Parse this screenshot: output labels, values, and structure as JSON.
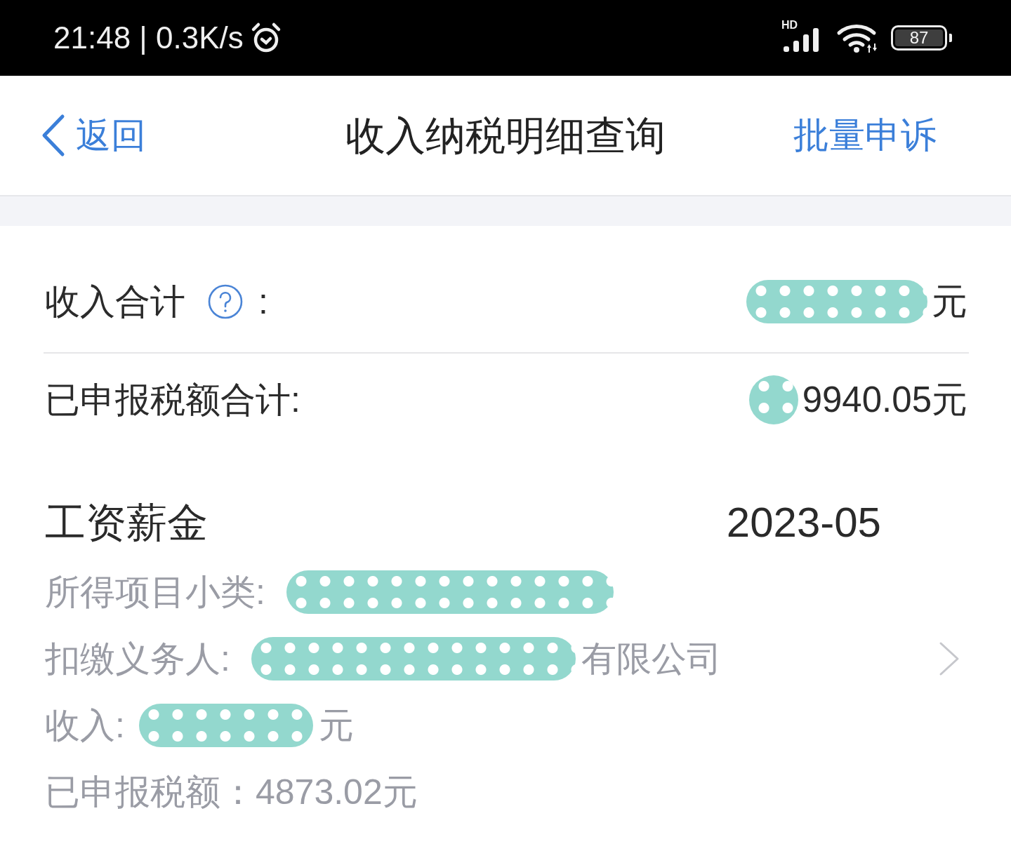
{
  "status_bar": {
    "time": "21:48 | 0.3K/s",
    "signal_label": "HD",
    "battery": "87"
  },
  "header": {
    "back": "返回",
    "title": "收入纳税明细查询",
    "action": "批量申诉"
  },
  "summary": [
    {
      "label": "收入合计",
      "help": true,
      "suffix": ":",
      "masked": true,
      "value": "元"
    },
    {
      "label": "已申报税额合计:",
      "help": false,
      "masked": true,
      "value": "9940.05元"
    }
  ],
  "records": [
    {
      "category": "工资薪金",
      "period": "2023-05",
      "lines": [
        {
          "label": "所得项目小类:",
          "masked": true,
          "chevron": false
        },
        {
          "label": "扣缴义务人:",
          "masked": true,
          "value": "有限公司",
          "chevron": true
        },
        {
          "label": "收入:",
          "masked": true,
          "value": "元",
          "chevron": false
        },
        {
          "label": "已申报税额：4873.02元",
          "masked": false,
          "chevron": false
        }
      ]
    }
  ]
}
